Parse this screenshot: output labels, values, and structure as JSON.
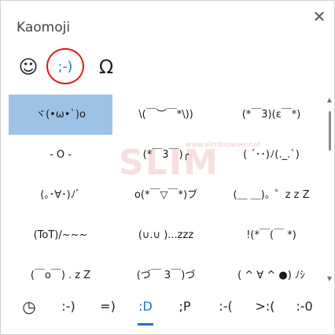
{
  "window": {
    "title": "Kaomoji",
    "close_glyph": "✕"
  },
  "category_tabs": [
    {
      "name": "emoji",
      "glyph": "☺",
      "icon": "smiley-icon"
    },
    {
      "name": "kaomoji",
      "glyph": ";-)",
      "icon": "kaomoji-icon",
      "selected": true
    },
    {
      "name": "symbols",
      "glyph": "Ω",
      "icon": "omega-icon"
    }
  ],
  "kaomoji_grid": [
    [
      "ヾ(•ω•`)o",
      "\\(￣︶￣*\\))",
      "(*￣3)(ε￣*)"
    ],
    [
      "- O -",
      "(*￣3￣)╭",
      "( ´･･)ﾉ(._.`)"
    ],
    [
      "(｡･∀･)ﾉﾞ",
      "o(*￣▽￣*)ブ",
      "(＿ ＿)。゜z z Z"
    ],
    [
      "(ToT)/~~~",
      "(∪.∪ )...zzz",
      "!(*￣(￣  *)"
    ],
    [
      "(￣o￣) . z Z",
      "(づ￣ 3￣)づ",
      "( ^ ∀ ^ ●) ﾉｼ"
    ]
  ],
  "bottom_tabs": [
    {
      "label": "◷",
      "icon": "clock-icon"
    },
    {
      "label": ":-)"
    },
    {
      "label": "=)"
    },
    {
      "label": ":D",
      "active": true
    },
    {
      "label": ";P"
    },
    {
      "label": ":-("
    },
    {
      "label": ">:("
    },
    {
      "label": ":-0"
    }
  ],
  "watermark": {
    "text": "SLIM",
    "small": "www.slimbrowser.net"
  },
  "colors": {
    "accent": "#1a73c8",
    "selected_cell": "#9cc3e6",
    "annotation_ring": "#e21a1a"
  }
}
